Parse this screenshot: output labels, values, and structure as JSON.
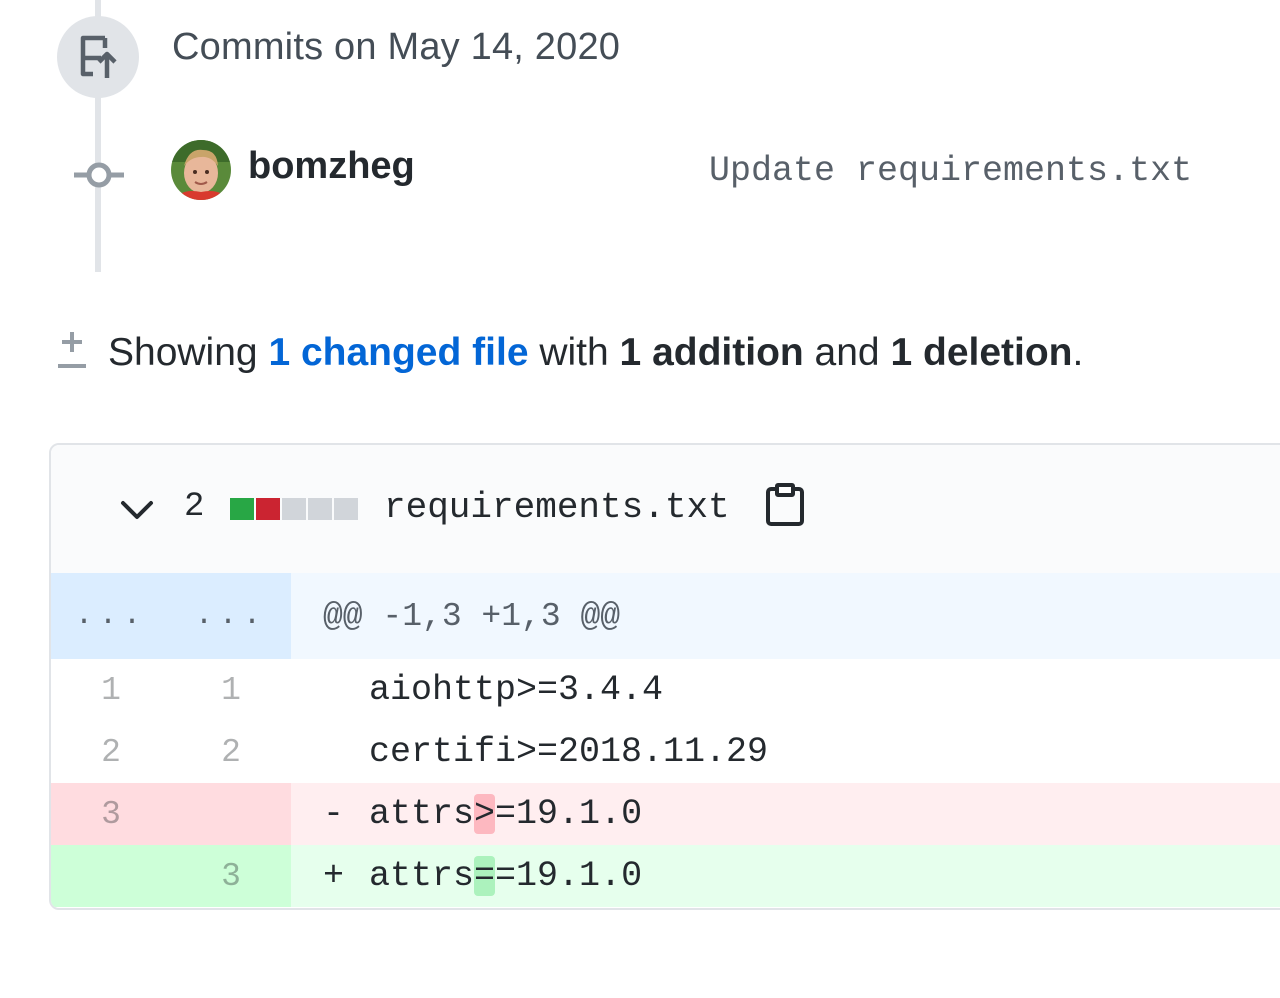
{
  "commit_group": {
    "title": "Commits on May 14, 2020",
    "icon": "git-commit-upload-icon"
  },
  "commit": {
    "author": "bomzheg",
    "message": "Update requirements.txt",
    "avatar_icon": "user-avatar"
  },
  "summary": {
    "prefix": "Showing ",
    "changed_files": "1 changed file",
    "with": " with ",
    "additions": "1 addition",
    "and": " and ",
    "deletions": "1 deletion",
    "period": "."
  },
  "file": {
    "change_count": "2",
    "name": "requirements.txt",
    "diffstat": [
      "added",
      "deleted",
      "neutral",
      "neutral",
      "neutral"
    ],
    "copy_icon": "clipboard-icon",
    "expand_icon": "chevron-down-icon"
  },
  "diff": {
    "hunk": {
      "old_num": "...",
      "new_num": "...",
      "header": "@@ -1,3 +1,3 @@"
    },
    "lines": [
      {
        "type": "context",
        "old": "1",
        "new": "1",
        "marker": " ",
        "before": "aiohttp>=3.4.4",
        "highlight": "",
        "after": ""
      },
      {
        "type": "context",
        "old": "2",
        "new": "2",
        "marker": " ",
        "before": "certifi>=2018.11.29",
        "highlight": "",
        "after": ""
      },
      {
        "type": "deletion",
        "old": "3",
        "new": "",
        "marker": "-",
        "before": "attrs",
        "highlight": ">",
        "after": "=19.1.0"
      },
      {
        "type": "addition",
        "old": "",
        "new": "3",
        "marker": "+",
        "before": "attrs",
        "highlight": "=",
        "after": "=19.1.0"
      }
    ]
  },
  "colors": {
    "link": "#0366d6",
    "addition_bg": "#e6ffed",
    "deletion_bg": "#ffeef0",
    "hunk_bg": "#f1f8ff",
    "diffstat_added": "#28a745",
    "diffstat_deleted": "#cb2431",
    "diffstat_neutral": "#d1d5da"
  }
}
